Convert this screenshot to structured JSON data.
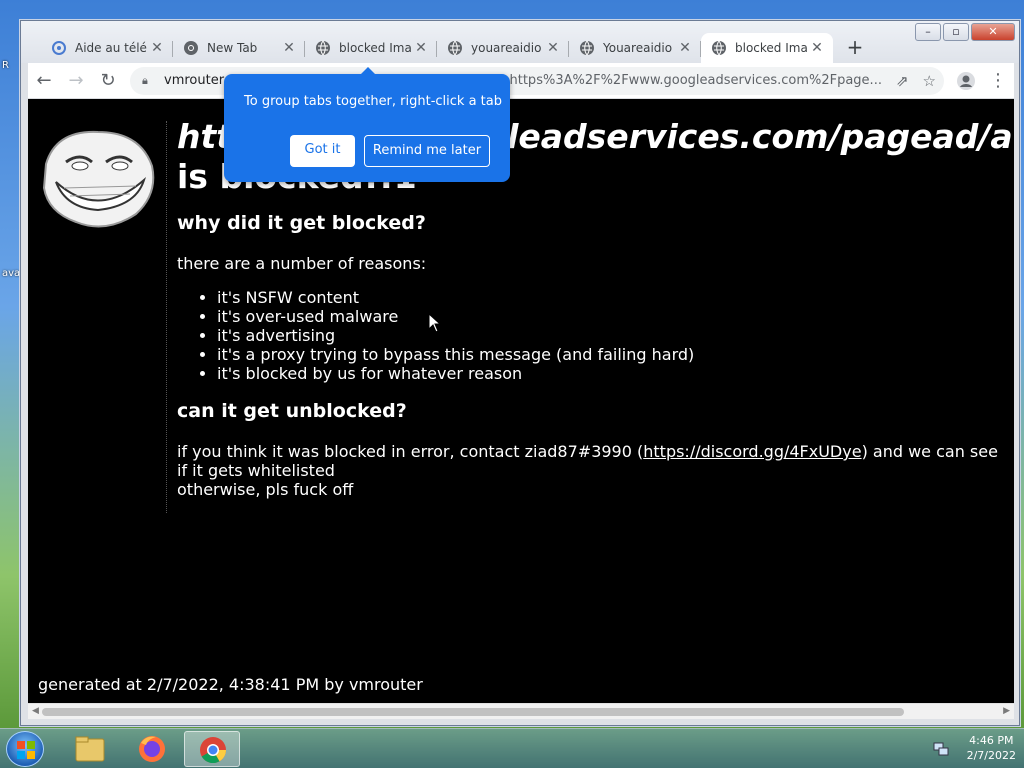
{
  "desktop": {
    "side_labels": [
      "R",
      "ava"
    ]
  },
  "browser": {
    "tabs": [
      {
        "title": "Aide au télé",
        "favicon": "settings-icon",
        "active": false
      },
      {
        "title": "New Tab",
        "favicon": "chrome-icon",
        "active": false
      },
      {
        "title": "blocked Ima",
        "favicon": "globe-icon",
        "active": false
      },
      {
        "title": "youareaidio",
        "favicon": "globe-icon",
        "active": false
      },
      {
        "title": "Youareaidio",
        "favicon": "globe-icon",
        "active": false
      },
      {
        "title": "blocked Ima",
        "favicon": "globe-icon",
        "active": true
      }
    ],
    "new_tab_label": "+",
    "address": {
      "host": "vmrouter",
      "rest": "=https%3A%2F%2Fwww.googleadservices.com%2Fpage..."
    },
    "tooltip": {
      "message": "To group tabs together, right-click a tab",
      "got_it": "Got it",
      "remind_later": "Remind me later"
    }
  },
  "page": {
    "heading_url": "https://www.googleadservices.com/pagead/a",
    "heading_rest": "is blocked!!1",
    "why_title": "why did it get blocked?",
    "reasons_intro": "there are a number of reasons:",
    "reasons": [
      "it's NSFW content",
      "it's over-used malware",
      "it's advertising",
      "it's a proxy trying to bypass this message (and failing hard)",
      "it's blocked by us for whatever reason"
    ],
    "unblock_title": "can it get unblocked?",
    "contact_prefix": "if you think it was blocked in error, contact ziad87#3990 (",
    "contact_link": "https://discord.gg/4FxUDye",
    "contact_suffix": ") and we can see if it gets whitelisted",
    "otherwise": "otherwise, pls fuck off",
    "footer": "generated at 2/7/2022, 4:38:41 PM by vmrouter"
  },
  "taskbar": {
    "apps": [
      "file-explorer-icon",
      "firefox-icon",
      "chrome-icon"
    ],
    "time": "4:46 PM",
    "date": "2/7/2022"
  },
  "colors": {
    "tooltip_bg": "#1a73e8",
    "page_bg": "#000000",
    "page_text": "#ffffff"
  }
}
